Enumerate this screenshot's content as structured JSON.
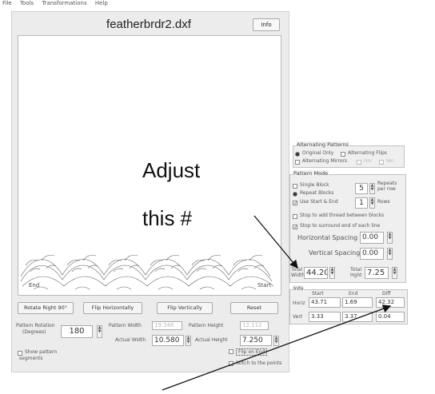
{
  "menu": [
    "File",
    "Tools",
    "Transformations",
    "Help"
  ],
  "window": {
    "title": "featherbrdr2.dxf",
    "info_button": "Info"
  },
  "canvas": {
    "end_label": "End",
    "start_label": "Start"
  },
  "buttons": {
    "rotate": "Rotate Right 90°",
    "flip_h": "Flip Horizontally",
    "flip_v": "Flip Vertically",
    "reset": "Reset"
  },
  "bottom": {
    "rotation_label_1": "Pattern Rotation",
    "rotation_label_2": "(Degrees)",
    "rotation_value": "180",
    "pattern_width_label": "Pattern Width",
    "pattern_width_value": "19.346",
    "pattern_height_label": "Pattern Height",
    "pattern_height_value": "12.112",
    "actual_width_label": "Actual Width",
    "actual_width_value": "10.580",
    "actual_height_label": "Actual Height",
    "actual_height_value": "7.250",
    "show_segments_1": "Show pattern",
    "show_segments_2": "segments",
    "flip_label": "Flip on End",
    "stitch_label": "Stitch to the points"
  },
  "alternating": {
    "title": "Alternating Patterns",
    "original_only": "Original Only",
    "alternating_flips": "Alternating Flips",
    "alternating_mirrors": "Alternating Mirrors",
    "horiz": "Hor",
    "vert": "Ver"
  },
  "pattern_mode": {
    "title": "Pattern Mode",
    "single_block": "Single Block",
    "single_block_value": "5",
    "repeats_label_1": "Repeats",
    "repeats_label_2": "per row",
    "repeat_blocks": "Repeat Blocks",
    "use_start_end": "Use Start & End",
    "rows_value": "1",
    "rows_label": "Rows",
    "stop_to_add": "Stop to add thread between blocks",
    "stop_to_surround": "Stop to surround end of each line",
    "horizontal_spacing_label": "Horizontal Spacing",
    "horizontal_spacing_value": "0.00",
    "vertical_spacing_label": "Vertical Spacing",
    "vertical_spacing_value": "0.00",
    "total_width_label_1": "Total",
    "total_width_label_2": "Width",
    "total_width_value": "44.20",
    "total_height_label_1": "Total",
    "total_height_label_2": "Hght",
    "total_height_value": "7.25"
  },
  "info": {
    "title": "Info",
    "col_start": "Start",
    "col_end": "End",
    "col_diff": "Diff",
    "row_horiz": "Horiz",
    "row_vert": "Vert",
    "horiz_start": "43.71",
    "horiz_end": "1.69",
    "horiz_diff": "42.32",
    "vert_start": "3.33",
    "vert_end": "3.37",
    "vert_diff": "0.04"
  },
  "annotation": {
    "line1": "Adjust",
    "line2": "this #"
  }
}
